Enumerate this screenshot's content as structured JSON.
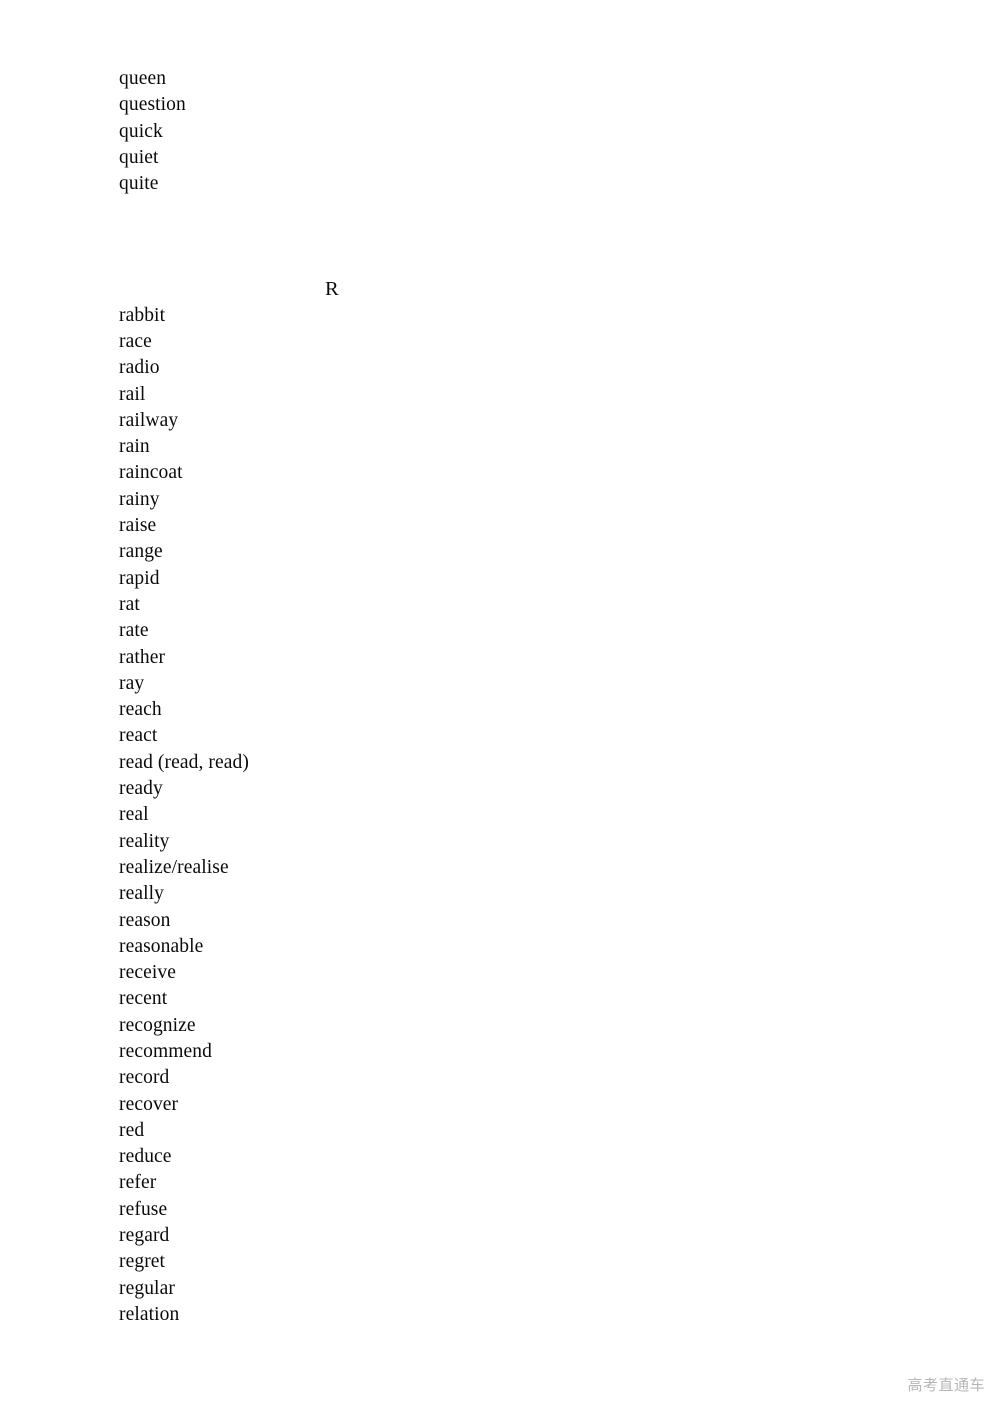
{
  "document": {
    "type": "vocabulary-word-list",
    "page_background": "#ffffff",
    "text_color": "#0a0a0a"
  },
  "q_section": {
    "words": [
      "queen",
      "question",
      "quick",
      "quiet",
      "quite"
    ]
  },
  "r_section": {
    "heading": "R",
    "words": [
      "rabbit",
      "race",
      "radio",
      "rail",
      "railway",
      "rain",
      "raincoat",
      "rainy",
      "raise",
      "range",
      "rapid",
      "rat",
      "rate",
      "rather",
      "ray",
      "reach",
      "react",
      "read (read, read)",
      "ready",
      "real",
      "reality",
      "realize/realise",
      "really",
      "reason",
      "reasonable",
      "receive",
      "recent",
      "recognize",
      "recommend",
      "record",
      "recover",
      "red",
      "reduce",
      "refer",
      "refuse",
      "regard",
      "regret",
      "regular",
      "relation"
    ]
  },
  "watermark": {
    "text": "高考直通车",
    "color": "#b7b7b7"
  }
}
